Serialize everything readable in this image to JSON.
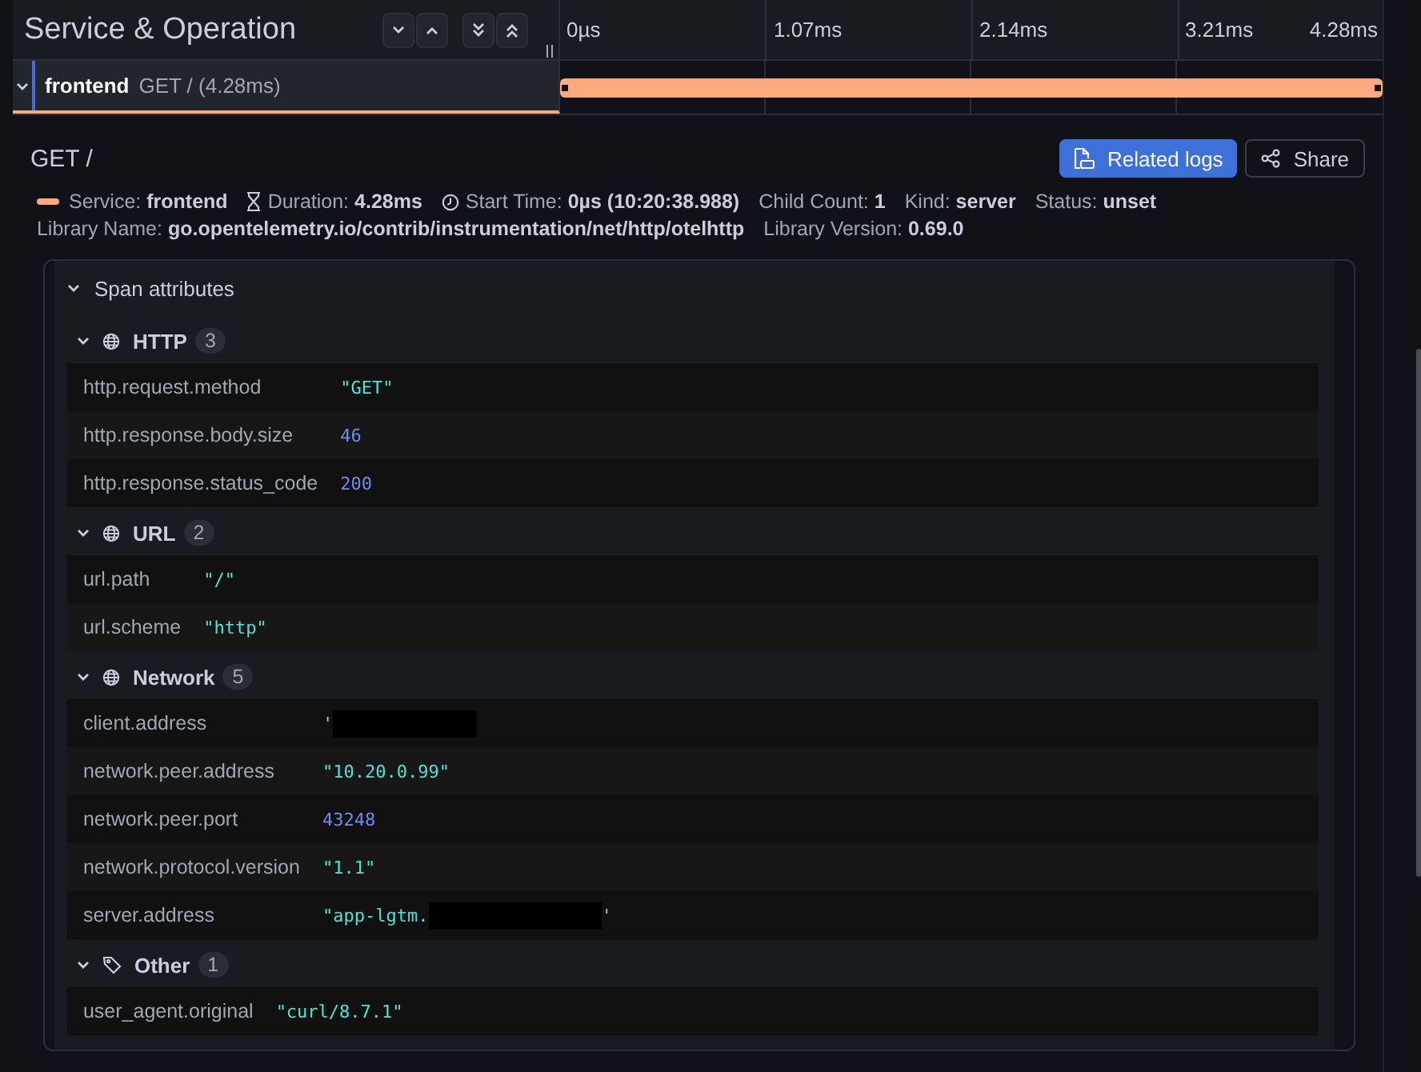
{
  "header": {
    "title": "Service & Operation",
    "ticks": [
      "0µs",
      "1.07ms",
      "2.14ms",
      "3.21ms",
      "4.28ms"
    ]
  },
  "span": {
    "service": "frontend",
    "operation": "GET / (4.28ms)",
    "color": "#ffa97f",
    "expanded": true
  },
  "details": {
    "title": "GET /",
    "buttons": [
      {
        "kind": "logs",
        "label": "Related logs"
      },
      {
        "kind": "share",
        "label": "Share"
      }
    ],
    "meta": [
      {
        "label": "Service:",
        "value": "frontend",
        "kind": "service"
      },
      {
        "label": "Duration:",
        "value": "4.28ms",
        "kind": "duration"
      },
      {
        "label": "Start Time:",
        "value": "0µs (10:20:38.988)",
        "kind": "time"
      },
      {
        "label": "Child Count:",
        "value": "1",
        "kind": "plain"
      },
      {
        "label": "Kind:",
        "value": "server",
        "kind": "plain"
      },
      {
        "label": "Status:",
        "value": "unset",
        "kind": "plain"
      }
    ],
    "library": [
      {
        "label": "Library Name:",
        "value": "go.opentelemetry.io/contrib/instrumentation/net/http/otelhttp"
      },
      {
        "label": "Library Version:",
        "value": "0.69.0"
      }
    ]
  },
  "attributes": {
    "title": "Span attributes",
    "expanded": true,
    "groups": [
      {
        "name": "HTTP",
        "count": "3",
        "kind": "globe",
        "expanded": true,
        "rows": [
          {
            "key": "http.request.method",
            "value": "\"GET\"",
            "kind": "string"
          },
          {
            "key": "http.response.body.size",
            "value": "46",
            "kind": "number"
          },
          {
            "key": "http.response.status_code",
            "value": "200",
            "kind": "number"
          }
        ]
      },
      {
        "name": "URL",
        "count": "2",
        "kind": "globe",
        "expanded": true,
        "rows": [
          {
            "key": "url.path",
            "value": "\"/\"",
            "kind": "string"
          },
          {
            "key": "url.scheme",
            "value": "\"http\"",
            "kind": "string"
          }
        ]
      },
      {
        "name": "Network",
        "count": "5",
        "kind": "globe",
        "expanded": true,
        "rows": [
          {
            "key": "client.address",
            "value": "'",
            "kind": "string",
            "redacted": true
          },
          {
            "key": "network.peer.address",
            "value": "\"10.20.0.99\"",
            "kind": "string"
          },
          {
            "key": "network.peer.port",
            "value": "43248",
            "kind": "number"
          },
          {
            "key": "network.protocol.version",
            "value": "\"1.1\"",
            "kind": "string"
          },
          {
            "key": "server.address",
            "value": "\"app-lgtm.",
            "kind": "string",
            "redacted": true,
            "tail": "'"
          }
        ]
      },
      {
        "name": "Other",
        "count": "1",
        "kind": "tag",
        "expanded": true,
        "rows": [
          {
            "key": "user_agent.original",
            "value": "\"curl/8.7.1\"",
            "kind": "string"
          }
        ]
      }
    ]
  }
}
